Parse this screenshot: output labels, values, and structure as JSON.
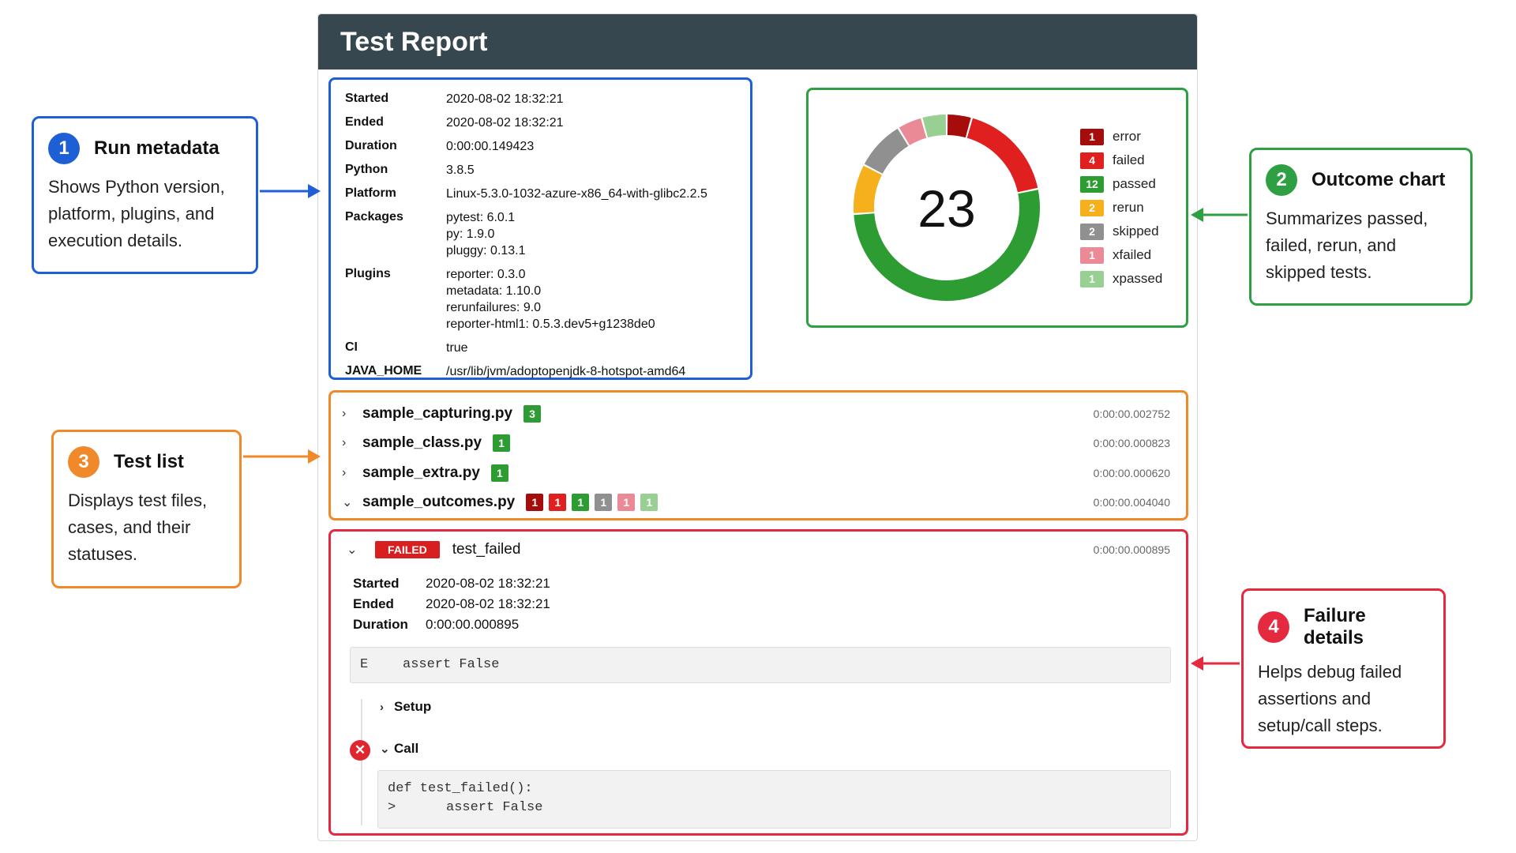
{
  "report": {
    "title": "Test Report",
    "metadata": [
      {
        "key": "Started",
        "value": [
          "2020-08-02 18:32:21"
        ]
      },
      {
        "key": "Ended",
        "value": [
          "2020-08-02 18:32:21"
        ]
      },
      {
        "key": "Duration",
        "value": [
          "0:00:00.149423"
        ]
      },
      {
        "key": "Python",
        "value": [
          "3.8.5"
        ]
      },
      {
        "key": "Platform",
        "value": [
          "Linux-5.3.0-1032-azure-x86_64-with-glibc2.2.5"
        ]
      },
      {
        "key": "Packages",
        "value": [
          "pytest: 6.0.1",
          "py: 1.9.0",
          "pluggy: 0.13.1"
        ]
      },
      {
        "key": "Plugins",
        "value": [
          "reporter: 0.3.0",
          "metadata: 1.10.0",
          "rerunfailures: 9.0",
          "reporter-html1: 0.5.3.dev5+g1238de0"
        ]
      },
      {
        "key": "CI",
        "value": [
          "true"
        ]
      },
      {
        "key": "JAVA_HOME",
        "value": [
          "/usr/lib/jvm/adoptopenjdk-8-hotspot-amd64"
        ]
      }
    ]
  },
  "chart_data": {
    "type": "pie",
    "center_label": "23",
    "categories": [
      "error",
      "failed",
      "passed",
      "rerun",
      "skipped",
      "xfailed",
      "xpassed"
    ],
    "values": [
      1,
      4,
      12,
      2,
      2,
      1,
      1
    ],
    "colors": [
      "#a50d0d",
      "#e01f1f",
      "#2d9c33",
      "#f5b01c",
      "#909090",
      "#ea8a96",
      "#98cf93"
    ],
    "legend_position": "right"
  },
  "test_list": [
    {
      "name": "sample_capturing.py",
      "expanded": false,
      "duration": "0:00:00.002752",
      "badges": [
        {
          "count": "3",
          "color": "#2d9c33"
        }
      ]
    },
    {
      "name": "sample_class.py",
      "expanded": false,
      "duration": "0:00:00.000823",
      "badges": [
        {
          "count": "1",
          "color": "#2d9c33"
        }
      ]
    },
    {
      "name": "sample_extra.py",
      "expanded": false,
      "duration": "0:00:00.000620",
      "badges": [
        {
          "count": "1",
          "color": "#2d9c33"
        }
      ]
    },
    {
      "name": "sample_outcomes.py",
      "expanded": true,
      "duration": "0:00:00.004040",
      "badges": [
        {
          "count": "1",
          "color": "#a50d0d"
        },
        {
          "count": "1",
          "color": "#e01f1f"
        },
        {
          "count": "1",
          "color": "#2d9c33"
        },
        {
          "count": "1",
          "color": "#909090"
        },
        {
          "count": "1",
          "color": "#ea8a96"
        },
        {
          "count": "1",
          "color": "#98cf93"
        }
      ]
    }
  ],
  "failure": {
    "status": "FAILED",
    "name": "test_failed",
    "duration": "0:00:00.000895",
    "details": [
      {
        "key": "Started",
        "value": "2020-08-02 18:32:21"
      },
      {
        "key": "Ended",
        "value": "2020-08-02 18:32:21"
      },
      {
        "key": "Duration",
        "value": "0:00:00.000895"
      }
    ],
    "error_prefix": "E",
    "error_text": "assert False",
    "setup_label": "Setup",
    "call_label": "Call",
    "code_line1": "def test_failed():",
    "code_marker": ">",
    "code_line2": "assert False"
  },
  "callouts": {
    "c1": {
      "number": "1",
      "title": "Run metadata",
      "body": "Shows Python version, platform, plugins, and execution details."
    },
    "c2": {
      "number": "2",
      "title": "Outcome chart",
      "body": "Summarizes passed, failed, rerun, and skipped tests."
    },
    "c3": {
      "number": "3",
      "title": "Test list",
      "body": "Displays test files, cases, and their statuses."
    },
    "c4": {
      "number": "4",
      "title": "Failure details",
      "body": "Helps debug failed assertions and setup/call steps."
    }
  },
  "icons": {
    "collapsed": "›",
    "expanded": "⌄",
    "error": "✕"
  }
}
